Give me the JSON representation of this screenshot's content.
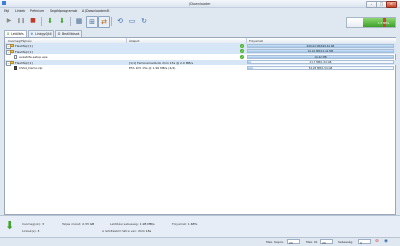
{
  "window": {
    "title": "JDownloader",
    "min": "–",
    "max": "□",
    "close": "✕"
  },
  "menu": [
    "Fájl",
    "Linkek",
    "Prémium",
    "Segédprogramok",
    "A JDownloaderről"
  ],
  "toolbar": {
    "play_icon": "▶",
    "pause_icon": "❚❚",
    "stop_icon": "■",
    "down_icon": "⬇",
    "down2_icon": "⬇",
    "grid_icon": "▦",
    "clip_icon": "⊞",
    "shuffle_icon": "⇄",
    "reconnect_icon": "⟲",
    "monitor_icon": "▭",
    "refresh_icon": "↻",
    "speed_label": "1.5 MB/s"
  },
  "tabs": [
    "Letöltés",
    "Linkgyűjtő",
    "Beállítások"
  ],
  "columns": [
    "Csomag/Fájlnév",
    "Állapot",
    "Folyamat"
  ],
  "rows": [
    {
      "name": "Flashfájl [1]",
      "status": "",
      "progress": 1.0,
      "text": "699.64 KB/699.64 KB",
      "type": "package",
      "selected": true,
      "ok": true
    },
    {
      "name": "Flashfájl [1]",
      "status": "",
      "progress": 1.0,
      "text": "10.42 MB/10.42 MB",
      "type": "package",
      "selected": true,
      "ok": true
    },
    {
      "name": "avastzfe-setup.exe",
      "status": "",
      "progress": 1.0,
      "text": "10.42 MB",
      "type": "file",
      "selected": false,
      "ok": true
    },
    {
      "name": "Flashfájl [1]",
      "status": "[1/1] Feminamadá kb 21m 15s @ 2.0 MB/s",
      "progress": 0.019,
      "text": "21.7 MB/1.54 GB",
      "type": "package",
      "selected": false,
      "ok": false
    },
    {
      "name": "CSS4_Demo.zip",
      "status": "ETA 1h5 15s @ 1.96 MB/s (4/4)",
      "progress": 0.035,
      "text": "54.28 MB/1.54 GB",
      "type": "file-dark",
      "selected": false,
      "ok": false
    }
  ],
  "footer": {
    "csomagok_label": "Csomag(ok):",
    "csomagok_value": "3",
    "linkek_label": "Linkek(s):",
    "linkek_value": "3",
    "teljes_label": "Teljes méret:",
    "teljes_value": "2.33 GB",
    "sebesseg_label": "Letöltési sebesség:",
    "sebesseg_value": "1.98 MB/s",
    "hatralevo_label": "A letöltésből hátra van:",
    "hatralevo_value": "21m 18s",
    "folyamat_label": "Folyamat:",
    "folyamat_value": "1.68%"
  },
  "statusbar": {
    "max_kapcs_label": "Max. Kapcs.",
    "max_kapcs_value": "20",
    "max_dl_label": "Max. Dl.",
    "max_dl_value": "20",
    "sebesseg_label": "Sebesség",
    "sebesseg_value": "0"
  },
  "colors": {
    "accent": "#3ea12a",
    "selection": "#d6e6f7",
    "progress": "#9fc4ea"
  }
}
